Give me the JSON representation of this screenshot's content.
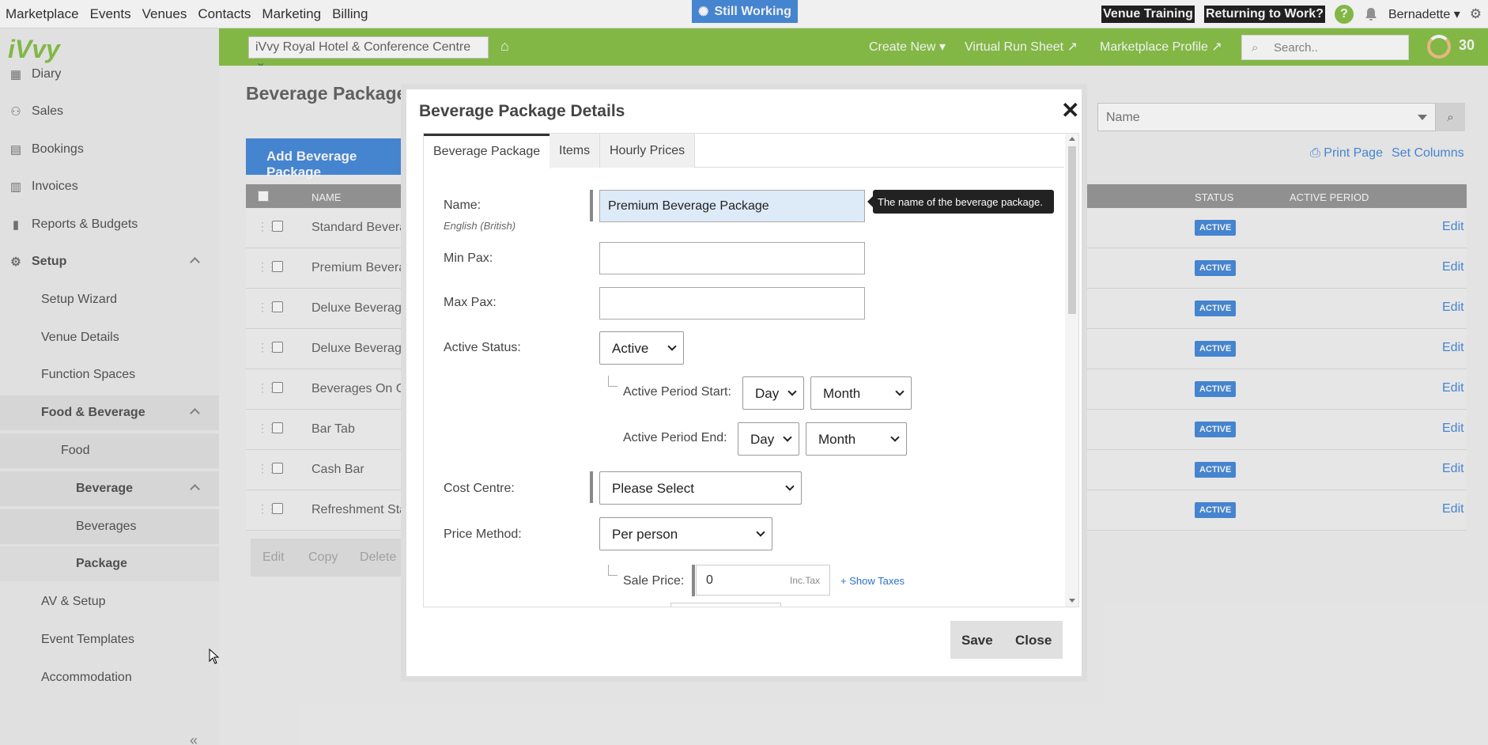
{
  "topnav": {
    "links": [
      "Marketplace",
      "Events",
      "Venues",
      "Contacts",
      "Marketing",
      "Billing"
    ],
    "status": "Still Working",
    "venue_training": "Venue Training",
    "returning": "Returning to Work?",
    "help": "?",
    "user": "Bernadette"
  },
  "greenbar": {
    "venue": "iVvy Royal Hotel & Conference Centre",
    "create_new": "Create New",
    "virtual_run_sheet": "Virtual Run Sheet",
    "marketplace_profile": "Marketplace Profile",
    "search_placeholder": "Search..",
    "score": "30"
  },
  "sidebar": {
    "logo": "iVvy",
    "items": [
      {
        "label": "Diary",
        "icon": "calendar-icon"
      },
      {
        "label": "Sales",
        "icon": "users-icon"
      },
      {
        "label": "Bookings",
        "icon": "briefcase-icon"
      },
      {
        "label": "Invoices",
        "icon": "table-icon"
      },
      {
        "label": "Reports & Budgets",
        "icon": "chart-icon"
      },
      {
        "label": "Setup",
        "icon": "gear-icon"
      },
      {
        "label": "Setup Wizard"
      },
      {
        "label": "Venue Details"
      },
      {
        "label": "Function Spaces"
      },
      {
        "label": "Food & Beverage"
      },
      {
        "label": "Food"
      },
      {
        "label": "Beverage"
      },
      {
        "label": "Beverages"
      },
      {
        "label": "Package"
      },
      {
        "label": "AV & Setup"
      },
      {
        "label": "Event Templates"
      },
      {
        "label": "Accommodation"
      }
    ],
    "collapse": "«"
  },
  "main": {
    "title": "Beverage Packages",
    "add_button": "Add Beverage Package",
    "name_filter": "Name",
    "print_page": "Print Page",
    "set_columns": "Set Columns",
    "columns": [
      "NAME",
      "STATUS",
      "ACTIVE PERIOD"
    ],
    "rows": [
      {
        "name": "Standard Beverag",
        "status": "ACTIVE",
        "action": "Edit"
      },
      {
        "name": "Premium Beverag",
        "status": "ACTIVE",
        "action": "Edit"
      },
      {
        "name": "Deluxe Beverage",
        "status": "ACTIVE",
        "action": "Edit"
      },
      {
        "name": "Deluxe Beverage",
        "status": "ACTIVE",
        "action": "Edit"
      },
      {
        "name": "Beverages On Co",
        "status": "ACTIVE",
        "action": "Edit"
      },
      {
        "name": "Bar Tab",
        "status": "ACTIVE",
        "action": "Edit"
      },
      {
        "name": "Cash Bar",
        "status": "ACTIVE",
        "action": "Edit"
      },
      {
        "name": "Refreshment Stat",
        "status": "ACTIVE",
        "action": "Edit"
      }
    ],
    "bottom_buttons": [
      "Edit",
      "Copy",
      "Delete"
    ]
  },
  "modal": {
    "title": "Beverage Package Details",
    "close_x": "✕",
    "tabs": [
      "Beverage Package",
      "Items",
      "Hourly Prices"
    ],
    "name_label": "Name:",
    "name_lang": "English (British)",
    "name_value": "Premium Beverage Package",
    "tooltip": "The name of the beverage package.",
    "min_pax_label": "Min Pax:",
    "max_pax_label": "Max Pax:",
    "active_status_label": "Active Status:",
    "active_status_value": "Active",
    "period_start_label": "Active Period Start:",
    "period_end_label": "Active Period End:",
    "day": "Day",
    "month": "Month",
    "cost_centre_label": "Cost Centre:",
    "cost_centre_value": "Please Select",
    "price_method_label": "Price Method:",
    "price_method_value": "Per person",
    "sale_price_label": "Sale Price:",
    "sale_price_value": "0",
    "inc_tax": "Inc.Tax",
    "show_taxes": "+ Show Taxes",
    "save": "Save",
    "close": "Close"
  }
}
